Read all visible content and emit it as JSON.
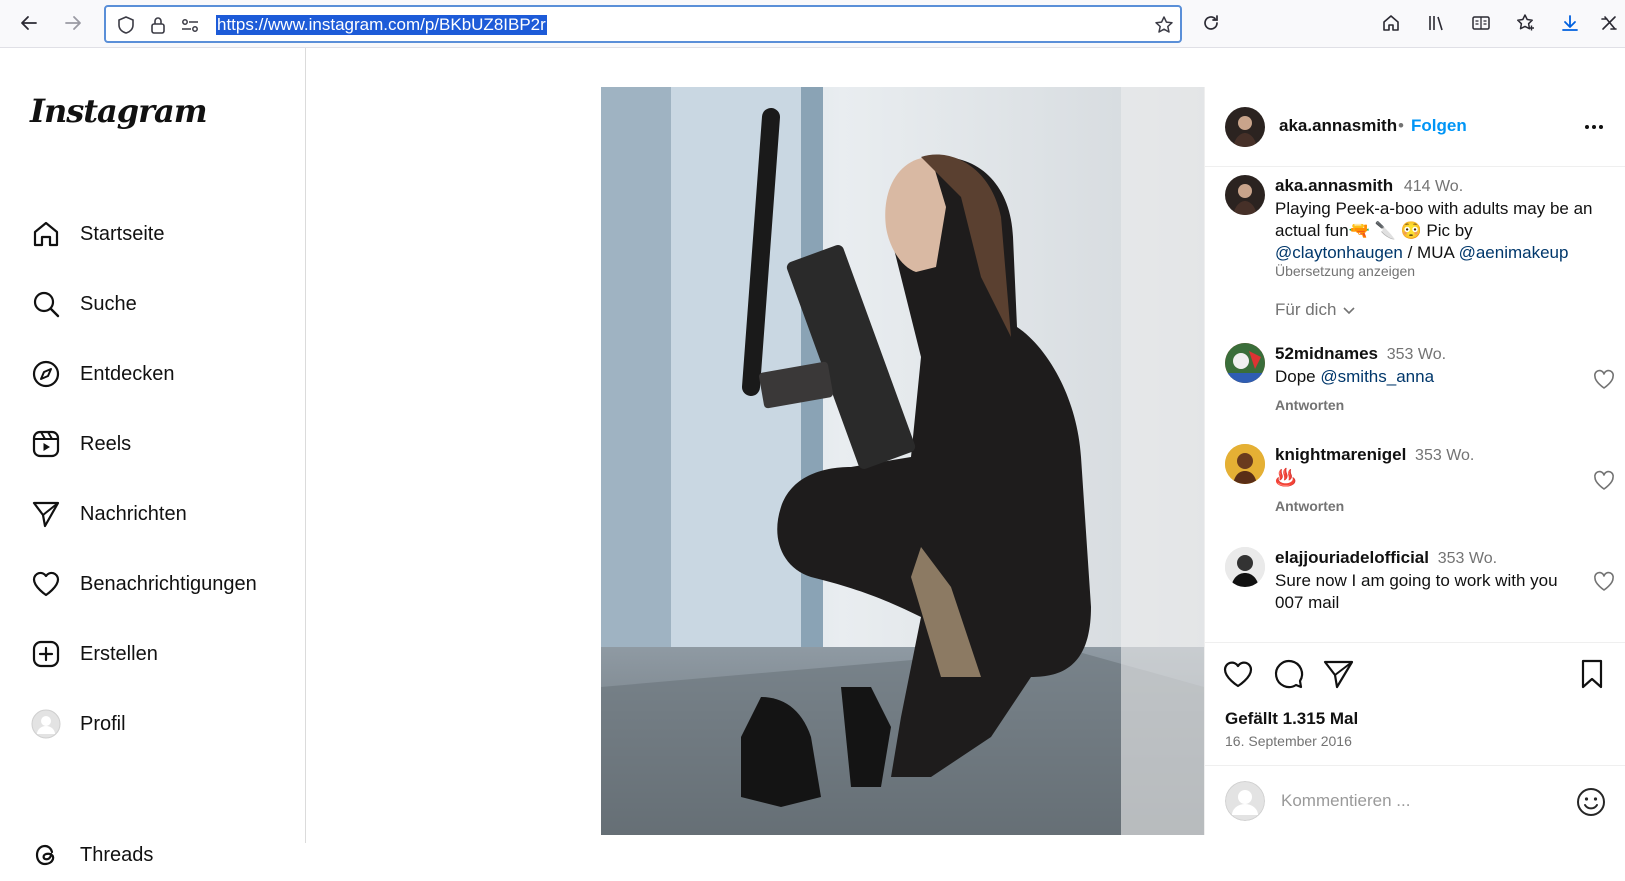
{
  "browser": {
    "url": "https://www.instagram.com/p/BKbUZ8IBP2r",
    "icons": [
      "back-arrow-icon",
      "forward-arrow-icon",
      "shield-icon",
      "lock-icon",
      "permissions-icon",
      "bookmark-star-icon",
      "reload-icon",
      "home-icon",
      "library-icon",
      "reader-view-icon",
      "extensions-icon",
      "downloads-icon",
      "customize-icon"
    ]
  },
  "sidebar": {
    "logo": "Instagram",
    "items": [
      {
        "label": "Startseite",
        "icon": "home-icon"
      },
      {
        "label": "Suche",
        "icon": "search-icon"
      },
      {
        "label": "Entdecken",
        "icon": "compass-icon"
      },
      {
        "label": "Reels",
        "icon": "reels-icon"
      },
      {
        "label": "Nachrichten",
        "icon": "paper-plane-icon"
      },
      {
        "label": "Benachrichtigungen",
        "icon": "heart-icon"
      },
      {
        "label": "Erstellen",
        "icon": "plus-square-icon"
      },
      {
        "label": "Profil",
        "icon": "profile-avatar-icon"
      },
      {
        "label": "Threads",
        "icon": "threads-icon"
      }
    ]
  },
  "post": {
    "author": "aka.annasmith",
    "follow_separator": "•",
    "follow_label": "Folgen",
    "caption": {
      "username": "aka.annasmith",
      "time": "414 Wo.",
      "text": "Playing Peek-a-boo with adults may be an actual fun🔫 🔪 😳 Pic by",
      "mention1": "@claytonhaugen",
      "sep": " / MUA ",
      "mention2": "@aenimakeup",
      "translate": "Übersetzung anzeigen"
    },
    "for_you": "Für dich",
    "comments": [
      {
        "username": "52midnames",
        "time": "353 Wo.",
        "text": "Dope ",
        "mention": "@smiths_anna",
        "reply": "Antworten"
      },
      {
        "username": "knightmarenigel",
        "time": "353 Wo.",
        "text": "♨️",
        "mention": "",
        "reply": "Antworten"
      },
      {
        "username": "elajjouriadelofficial",
        "time": "353 Wo.",
        "text": "Sure now I am going to work with you 007 mail",
        "mention": "",
        "reply": ""
      }
    ],
    "likes": "Gefällt 1.315 Mal",
    "date": "16. September 2016",
    "comment_placeholder": "Kommentieren ..."
  }
}
